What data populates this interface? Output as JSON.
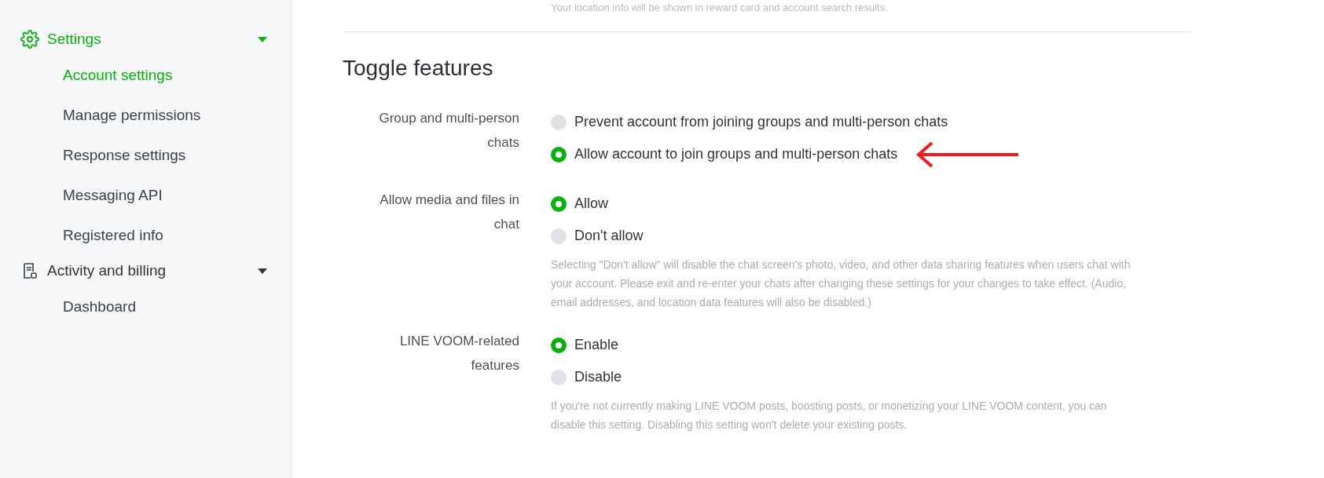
{
  "sidebar": {
    "sections": [
      {
        "label": "Settings",
        "kind": "gear",
        "expanded": true,
        "selected": true,
        "items": [
          {
            "label": "Account settings",
            "selected": true
          },
          {
            "label": "Manage permissions",
            "selected": false
          },
          {
            "label": "Response settings",
            "selected": false
          },
          {
            "label": "Messaging API",
            "selected": false
          },
          {
            "label": "Registered info",
            "selected": false
          }
        ]
      },
      {
        "label": "Activity and billing",
        "kind": "document",
        "expanded": true,
        "selected": false,
        "items": [
          {
            "label": "Dashboard",
            "selected": false
          }
        ]
      }
    ]
  },
  "top_note": "Your location info will be shown in reward card and account search results.",
  "section_title": "Toggle features",
  "settings": [
    {
      "label": "Group and multi-person chats",
      "options": [
        {
          "label": "Prevent account from joining groups and multi-person chats",
          "selected": false,
          "arrow": false
        },
        {
          "label": "Allow account to join groups and multi-person chats",
          "selected": true,
          "arrow": true
        }
      ]
    },
    {
      "label": "Allow media and files in chat",
      "options": [
        {
          "label": "Allow",
          "selected": true,
          "arrow": false
        },
        {
          "label": "Don't allow",
          "selected": false,
          "arrow": false
        }
      ],
      "note": "Selecting \"Don't allow\" will disable the chat screen's photo, video, and other data sharing features when users chat with your account. Please exit and re-enter your chats after changing these settings for your changes to take effect. (Audio, email addresses, and location data features will also be disabled.)"
    },
    {
      "label": "LINE VOOM-related features",
      "options": [
        {
          "label": "Enable",
          "selected": true,
          "arrow": false
        },
        {
          "label": "Disable",
          "selected": false,
          "arrow": false
        }
      ],
      "note": "If you're not currently making LINE VOOM posts, boosting posts, or monetizing your LINE VOOM content, you can disable this setting. Disabling this setting won't delete your existing posts."
    }
  ]
}
